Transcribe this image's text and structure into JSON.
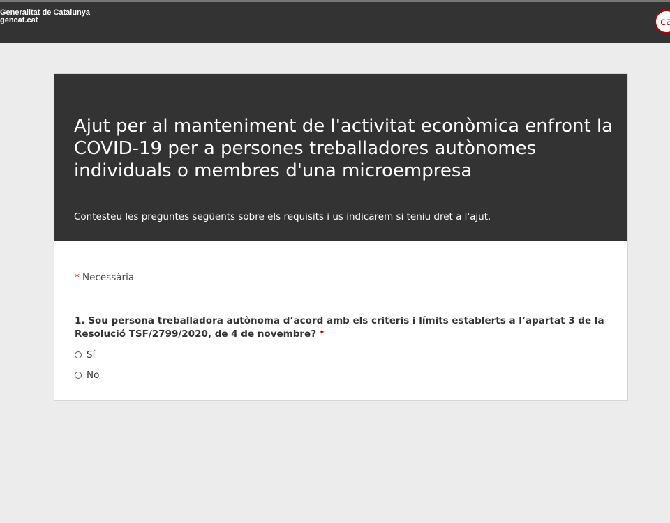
{
  "header": {
    "brand_line1": "Generalitat de Catalunya",
    "brand_line2": "gencat.cat",
    "language_badge": "ca"
  },
  "form": {
    "title": "Ajut per al manteniment de l'activitat econòmica enfront la COVID-19 per a persones treballadores autònomes individuals o membres d'una microempresa",
    "description": "Contesteu les preguntes següents sobre els requisits i us indicarem si teniu dret a l'ajut.",
    "required_marker": "*",
    "required_label": "Necessària",
    "question_1": {
      "text": "1. Sou persona treballadora autònoma d’acord amb els criteris i límits establerts a l’apartat 3 de la Resolució TSF/2799/2020, de 4 de novembre?",
      "required_marker": "*",
      "options": [
        "Sí",
        "No"
      ]
    }
  },
  "colors": {
    "dark_bg": "#333333",
    "page_bg": "#ececec",
    "accent_red": "#c00000"
  }
}
